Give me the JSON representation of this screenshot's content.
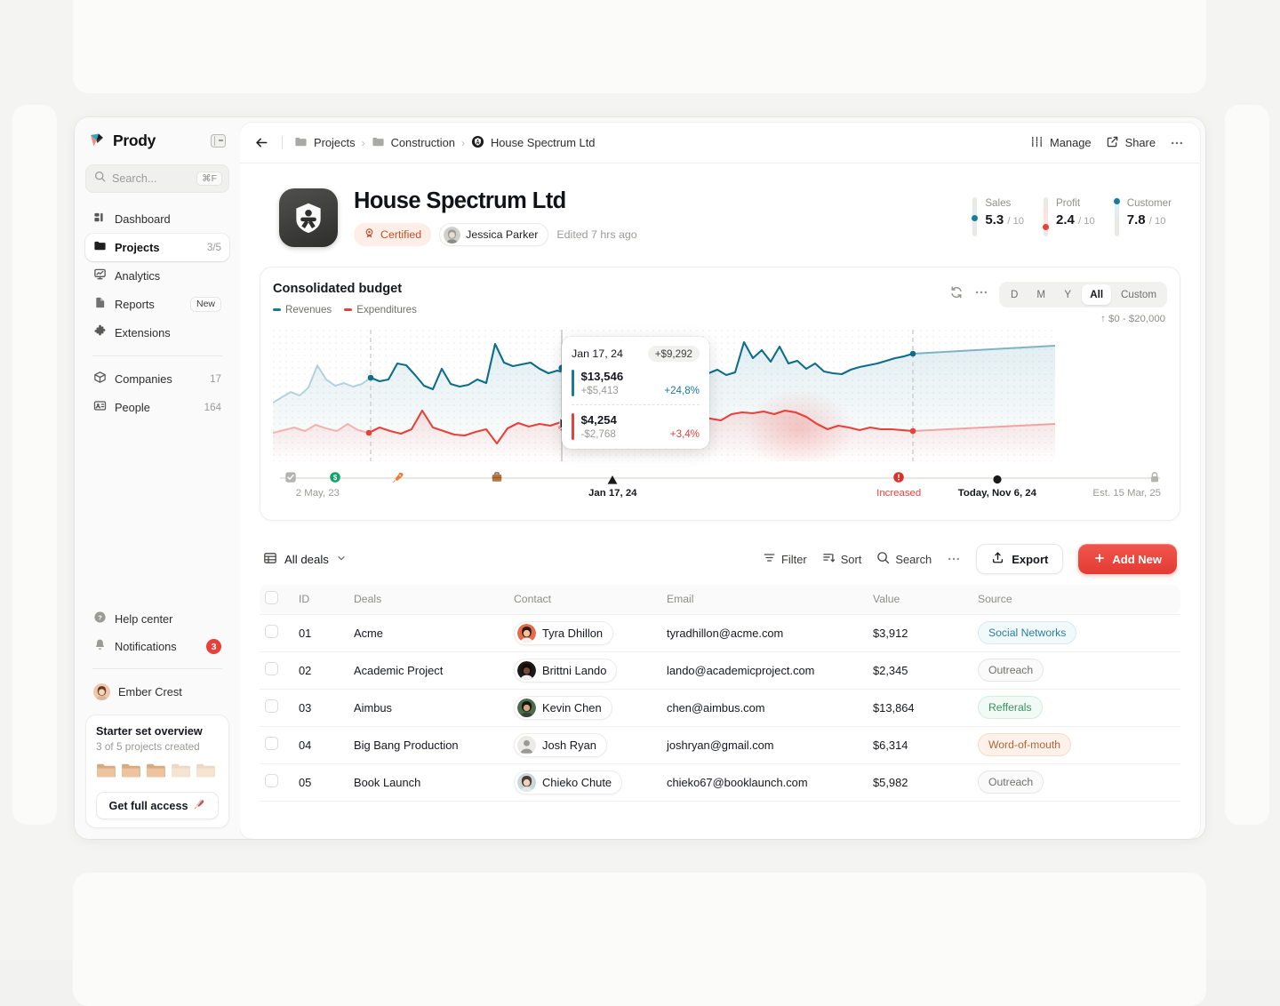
{
  "sidebar": {
    "brand": "Prody",
    "collapse_icon": "panel-collapse-icon",
    "search": {
      "placeholder": "Search...",
      "shortcut": "⌘F",
      "icon": "search-icon"
    },
    "nav": [
      {
        "label": "Dashboard",
        "icon": "dashboard-icon",
        "count": "",
        "badge": "",
        "active": false
      },
      {
        "label": "Projects",
        "icon": "folder-icon",
        "count": "3/5",
        "badge": "",
        "active": true
      },
      {
        "label": "Analytics",
        "icon": "analytics-icon",
        "count": "",
        "badge": "",
        "active": false
      },
      {
        "label": "Reports",
        "icon": "document-icon",
        "count": "",
        "badge": "New",
        "active": false
      },
      {
        "label": "Extensions",
        "icon": "puzzle-icon",
        "count": "",
        "badge": "",
        "active": false
      }
    ],
    "nav2": [
      {
        "label": "Companies",
        "icon": "box-icon",
        "count": "17"
      },
      {
        "label": "People",
        "icon": "contact-card-icon",
        "count": "164"
      }
    ],
    "bottom": [
      {
        "label": "Help center",
        "icon": "help-circle-icon",
        "badge": ""
      },
      {
        "label": "Notifications",
        "icon": "bell-icon",
        "badge": "3"
      }
    ],
    "user": {
      "name": "Ember Crest",
      "avatar": "user-avatar"
    },
    "starter": {
      "title": "Starter set overview",
      "subtitle": "3 of 5 projects created",
      "folders_filled": 3,
      "folders_total": 5,
      "cta": "Get full access",
      "cta_icon": "rocket-icon"
    }
  },
  "topbar": {
    "back_icon": "arrow-left-icon",
    "breadcrumbs": [
      {
        "label": "Projects",
        "icon": "folder-icon"
      },
      {
        "label": "Construction",
        "icon": "folder-icon"
      },
      {
        "label": "House Spectrum Ltd",
        "icon": "project-badge-icon"
      }
    ],
    "separator": "›",
    "actions": [
      {
        "label": "Manage",
        "icon": "sliders-icon"
      },
      {
        "label": "Share",
        "icon": "share-external-icon"
      }
    ],
    "more_icon": "more-horizontal-icon"
  },
  "project": {
    "icon": "house-spectrum-logo",
    "title": "House Spectrum Ltd",
    "certified_label": "Certified",
    "certified_icon": "award-icon",
    "owner": "Jessica Parker",
    "owner_avatar": "owner-avatar",
    "edited": "Edited 7 hrs ago",
    "kpis": [
      {
        "name": "Sales",
        "value": "5.3",
        "scale": "/ 10",
        "color": "#1b7b97",
        "fill": 0.53
      },
      {
        "name": "Profit",
        "value": "2.4",
        "scale": "/ 10",
        "color": "#e8413a",
        "fill": 0.24
      },
      {
        "name": "Customer",
        "value": "7.8",
        "scale": "/ 10",
        "color": "#1b7b97",
        "fill": 0.78
      }
    ]
  },
  "chart": {
    "title": "Consolidated budget",
    "refresh_icon": "refresh-icon",
    "more_icon": "more-horizontal-icon",
    "ranges": [
      "D",
      "M",
      "Y",
      "All",
      "Custom"
    ],
    "active_range": "All",
    "range_note": "↑ $0 - $20,000",
    "tooltip": {
      "date": "Jan 17, 24",
      "delta_chip": "+$9,292",
      "rows": [
        {
          "value": "$13,546",
          "change": "+$5,413",
          "percent": "+24,8%",
          "color": "#1b7b97"
        },
        {
          "value": "$4,254",
          "change": "-$2,768",
          "percent": "+3,4%",
          "color": "#e8413a"
        }
      ]
    },
    "timeline": [
      {
        "icon": "checkbox-icon",
        "label": "2 May, 23",
        "pos": 2,
        "style": "muted"
      },
      {
        "icon": "money-icon",
        "label": "",
        "pos": 7,
        "style": "muted"
      },
      {
        "icon": "rocket-icon",
        "label": "",
        "pos": 14,
        "style": "muted"
      },
      {
        "icon": "briefcase-icon",
        "label": "",
        "pos": 25,
        "style": "muted"
      },
      {
        "icon": "triangle-icon",
        "label": "Jan 17, 24",
        "pos": 38,
        "style": "dark"
      },
      {
        "icon": "alert-icon",
        "label": "Increased",
        "pos": 70,
        "style": "danger"
      },
      {
        "icon": "dot-icon",
        "label": "Today, Nov 6, 24",
        "pos": 81,
        "style": "dark"
      },
      {
        "icon": "lock-icon",
        "label": "Est. 15 Mar, 25",
        "pos": 99,
        "style": "muted"
      }
    ]
  },
  "chart_data": {
    "type": "line",
    "title": "Consolidated budget",
    "xlabel": "",
    "ylabel": "",
    "ylim": [
      0,
      20000
    ],
    "axis_note": "$0 - $20,000",
    "grid": "dotted",
    "legend_position": "top-left",
    "legend": [
      "Revenues",
      "Expenditures"
    ],
    "series": [
      {
        "name": "Revenues",
        "color": "#1b7b97",
        "values": [
          7600,
          8100,
          8600,
          8200,
          9100,
          11800,
          10200,
          9400,
          9700,
          9200,
          9600,
          10400,
          9900,
          10100,
          11900,
          11700,
          10500,
          9400,
          8900,
          11100,
          9100,
          8800,
          9000,
          9600,
          9200,
          16100,
          13200,
          12700,
          13000,
          13200,
          12400,
          11800,
          12100,
          11800,
          10400,
          11300,
          12200,
          11500,
          11800,
          12100,
          13546,
          12900,
          12300,
          11600,
          10800,
          11400,
          11900,
          11100,
          10300,
          11800,
          12200,
          11500,
          11900,
          16600,
          14200,
          15300,
          13800,
          15800,
          13500,
          13900,
          12900,
          13700,
          12500,
          12200,
          12100,
          12800,
          13100,
          13400,
          13600,
          13900,
          14200,
          14600,
          15000,
          15300
        ]
      },
      {
        "name": "Expenditures",
        "color": "#e8413a",
        "values": [
          3500,
          3900,
          4200,
          3700,
          4600,
          4100,
          3800,
          4700,
          3900,
          3600,
          4300,
          3700,
          3400,
          4000,
          6700,
          4200,
          3800,
          3300,
          3200,
          3600,
          3900,
          3500,
          2200,
          4100,
          4800,
          4400,
          4700,
          4500,
          4900,
          4600,
          4800,
          4400,
          4700,
          4900,
          4600,
          6400,
          5200,
          4600,
          4254,
          4100,
          4400,
          4700,
          4200,
          5700,
          5300,
          5100,
          6200,
          6400,
          6300,
          6500,
          6200,
          6600,
          6400,
          5900,
          3900,
          4600,
          4400,
          3900,
          4200,
          4254,
          4400,
          4500,
          4600,
          4700,
          4800,
          4900,
          5000,
          5100,
          5200,
          5300,
          5400,
          5500,
          5600,
          5700
        ]
      }
    ],
    "highlight_point": {
      "x_label": "Jan 17, 24",
      "revenues": 13546,
      "expenditures": 4254
    },
    "forecast_start_label": "Today, Nov 6, 24"
  },
  "table": {
    "view": "All deals",
    "view_icon": "table-icon",
    "chevron_icon": "chevron-down-icon",
    "actions": [
      {
        "label": "Filter",
        "icon": "filter-icon"
      },
      {
        "label": "Sort",
        "icon": "sort-icon"
      },
      {
        "label": "Search",
        "icon": "search-icon"
      }
    ],
    "more_icon": "more-horizontal-icon",
    "export_label": "Export",
    "export_icon": "upload-icon",
    "add_label": "Add New",
    "add_icon": "plus-icon",
    "columns": [
      "ID",
      "Deals",
      "Contact",
      "Email",
      "Value",
      "Source"
    ],
    "rows": [
      {
        "id": "01",
        "deal": "Acme",
        "contact": "Tyra Dhillon",
        "email": "tyradhillon@acme.com",
        "value": "$3,912",
        "source": "Social Networks",
        "source_fg": "#2b7f9e",
        "source_bg": "#f2f9fb",
        "source_bd": "#d8eaf0"
      },
      {
        "id": "02",
        "deal": "Academic Project",
        "contact": "Brittni Lando",
        "email": "lando@academicproject.com",
        "value": "$2,345",
        "source": "Outreach",
        "source_fg": "#6f6f6c",
        "source_bg": "#fafafa",
        "source_bd": "#e7e7e4"
      },
      {
        "id": "03",
        "deal": "Aimbus",
        "contact": "Kevin Chen",
        "email": "chen@aimbus.com",
        "value": "$13,864",
        "source": "Refferals",
        "source_fg": "#3c8f63",
        "source_bg": "#f1faf4",
        "source_bd": "#d5eddf"
      },
      {
        "id": "04",
        "deal": "Big Bang Production",
        "contact": "Josh Ryan",
        "email": "joshryan@gmail.com",
        "value": "$6,314",
        "source": "Word-of-mouth",
        "source_fg": "#b0673a",
        "source_bg": "#fdf1e9",
        "source_bd": "#f4ddcb"
      },
      {
        "id": "05",
        "deal": "Book Launch",
        "contact": "Chieko Chute",
        "email": "chieko67@booklaunch.com",
        "value": "$5,982",
        "source": "Outreach",
        "source_fg": "#6f6f6c",
        "source_bg": "#fafafa",
        "source_bd": "#e7e7e4"
      }
    ]
  }
}
